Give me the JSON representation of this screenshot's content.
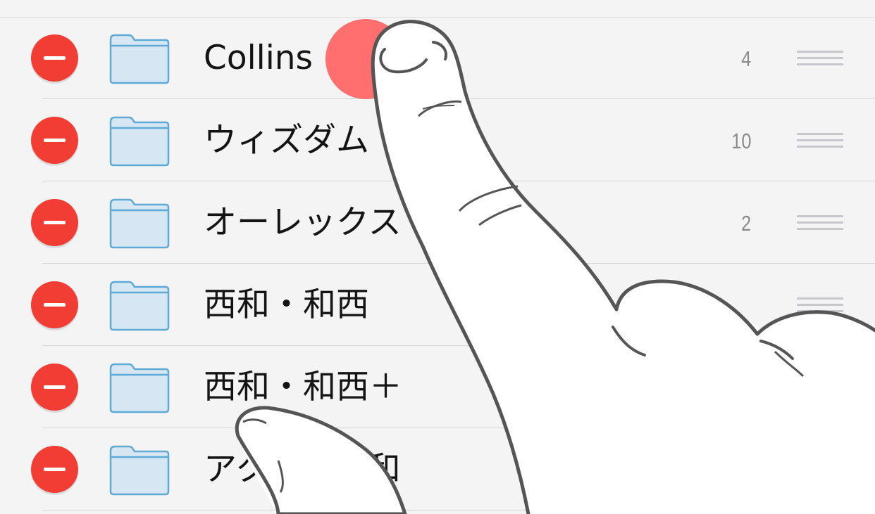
{
  "folders": [
    {
      "name": "Collins",
      "count": "4"
    },
    {
      "name": "ウィズダム",
      "count": "10"
    },
    {
      "name": "オーレックス",
      "count": "2"
    },
    {
      "name": "西和・和西",
      "count": ""
    },
    {
      "name": "西和・和西＋",
      "count": ""
    },
    {
      "name": "アクセス独和",
      "count": ""
    }
  ],
  "colors": {
    "delete": "#f23d34",
    "folder_fill": "#d6e7f3",
    "folder_stroke": "#5fa9d6",
    "touch": "#ff6363",
    "background": "#f4f4f4"
  },
  "icons": {
    "delete": "minus-circle-icon",
    "folder": "folder-icon",
    "reorder": "reorder-handle-icon"
  }
}
